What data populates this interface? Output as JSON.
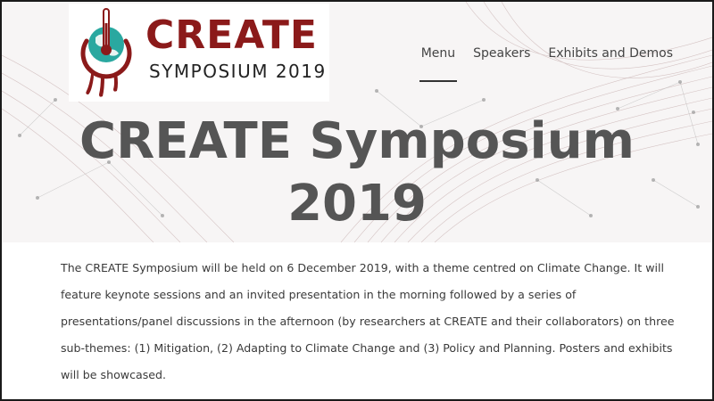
{
  "logo": {
    "wordmark": "CREATE",
    "subtitle": "SYMPOSIUM 2019"
  },
  "nav": {
    "items": [
      "Menu",
      "Speakers",
      "Exhibits and Demos"
    ],
    "active": "Menu"
  },
  "hero": {
    "title": "CREATE Symposium 2019"
  },
  "content": {
    "paragraph": "The CREATE Symposium will be held on 6 December 2019, with a theme centred on Climate Change. It will feature keynote sessions and an invited presentation in the morning followed by a series of presentations/panel discussions in the afternoon (by researchers at CREATE and their collaborators) on three sub-themes: (1) Mitigation, (2) Adapting to Climate Change and (3) Policy and Planning. Posters and exhibits will be showcased."
  },
  "colors": {
    "brand_red": "#8b1a1a",
    "globe_teal": "#2aa8a0",
    "title_gray": "#555555"
  }
}
